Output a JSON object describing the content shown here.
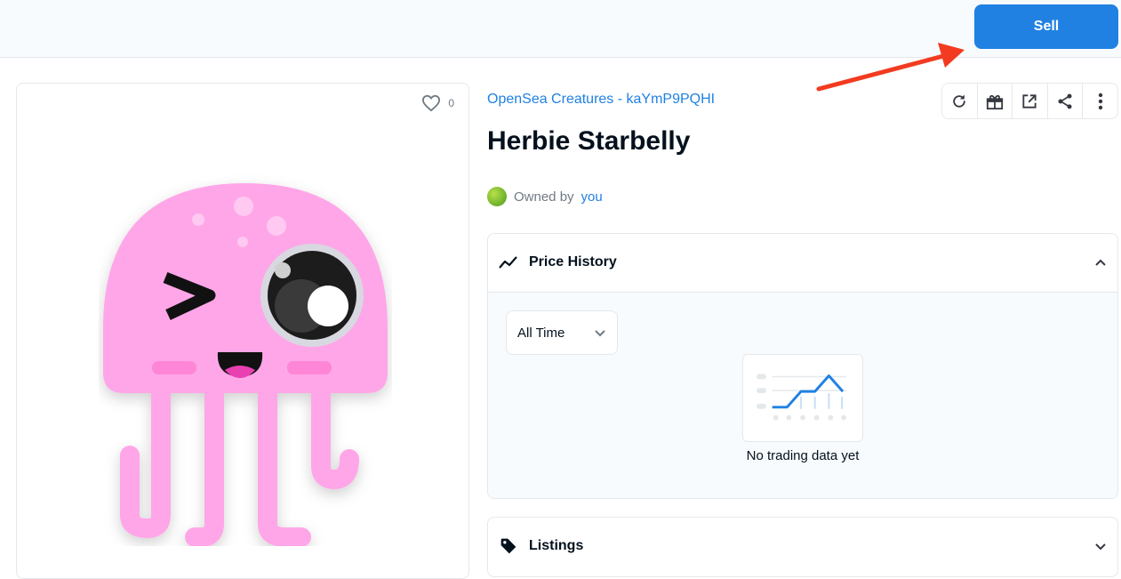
{
  "header": {
    "sell_label": "Sell"
  },
  "asset": {
    "favorites_count": "0",
    "collection_name": "OpenSea Creatures - kaYmP9PQHI",
    "title": "Herbie Starbelly",
    "owned_by_label": "Owned by",
    "owner_name": "you"
  },
  "actions": [
    {
      "icon": "refresh-icon"
    },
    {
      "icon": "gift-icon"
    },
    {
      "icon": "external-link-icon"
    },
    {
      "icon": "share-icon"
    },
    {
      "icon": "more-icon"
    }
  ],
  "price_history": {
    "title": "Price History",
    "range_selected": "All Time",
    "empty_text": "No trading data yet"
  },
  "listings": {
    "title": "Listings"
  },
  "colors": {
    "accent": "#2081e2",
    "annotation_arrow": "#f23b20",
    "creature": "#ffa6e8"
  }
}
